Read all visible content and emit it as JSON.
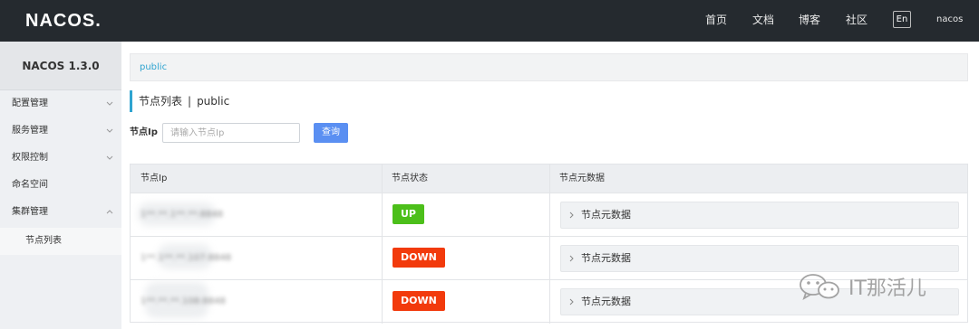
{
  "header": {
    "logo_text": "NACOS",
    "logo_dot": ".",
    "nav": [
      "首页",
      "文档",
      "博客",
      "社区"
    ],
    "lang": "En",
    "user": "nacos"
  },
  "sidebar": {
    "version": "NACOS 1.3.0",
    "items": [
      {
        "label": "配置管理",
        "chevron": "chevron-down-icon"
      },
      {
        "label": "服务管理",
        "chevron": "chevron-down-icon"
      },
      {
        "label": "权限控制",
        "chevron": "chevron-down-icon"
      },
      {
        "label": "命名空间"
      },
      {
        "label": "集群管理",
        "chevron": "chevron-up-icon"
      }
    ],
    "sub_item": "节点列表"
  },
  "main": {
    "namespace": "public",
    "title": "节点列表",
    "title_sep": "|",
    "title_ns": "public",
    "query_label": "节点Ip",
    "query_placeholder": "请输入节点Ip",
    "query_button": "查询",
    "table": {
      "headers": [
        "节点Ip",
        "节点状态",
        "节点元数据"
      ],
      "rows": [
        {
          "ip": "1**.**.1**.**:8848",
          "status": "UP",
          "status_color": "#4cbf1a",
          "meta": "节点元数据"
        },
        {
          "ip": "1**.1**.**.107:8848",
          "status": "DOWN",
          "status_color": "#f23a0c",
          "meta": "节点元数据"
        },
        {
          "ip": "1**.**.**.108:8848",
          "status": "DOWN",
          "status_color": "#f23a0c",
          "meta": "节点元数据"
        }
      ]
    }
  },
  "watermark": {
    "text": "IT那活儿",
    "icon": "wechat-icon"
  }
}
